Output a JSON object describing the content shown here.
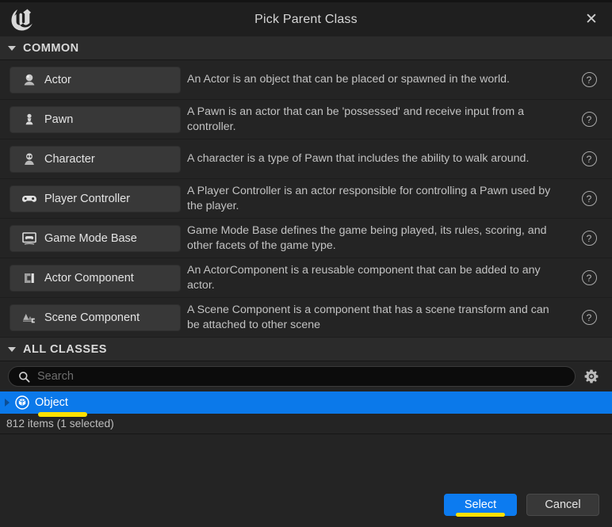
{
  "window": {
    "title": "Pick Parent Class",
    "logo_icon": "unreal-engine-logo",
    "close_icon": "close-icon"
  },
  "common_section": {
    "header": "COMMON",
    "collapse_icon": "triangle-down-icon",
    "items": [
      {
        "label": "Actor",
        "icon": "actor-icon",
        "description": "An Actor is an object that can be placed or spawned in the world.",
        "help_icon": "question-mark-icon"
      },
      {
        "label": "Pawn",
        "icon": "pawn-icon",
        "description": "A Pawn is an actor that can be 'possessed' and receive input from a controller.",
        "help_icon": "question-mark-icon"
      },
      {
        "label": "Character",
        "icon": "character-icon",
        "description": "A character is a type of Pawn that includes the ability to walk around.",
        "help_icon": "question-mark-icon"
      },
      {
        "label": "Player Controller",
        "icon": "gamepad-icon",
        "description": "A Player Controller is an actor responsible for controlling a Pawn used by the player.",
        "help_icon": "question-mark-icon"
      },
      {
        "label": "Game Mode Base",
        "icon": "game-mode-icon",
        "description": "Game Mode Base defines the game being played, its rules, scoring, and other facets of the game type.",
        "help_icon": "question-mark-icon"
      },
      {
        "label": "Actor Component",
        "icon": "actor-component-icon",
        "description": "An ActorComponent is a reusable component that can be added to any actor.",
        "help_icon": "question-mark-icon"
      },
      {
        "label": "Scene Component",
        "icon": "scene-component-icon",
        "description": "A Scene Component is a component that has a scene transform and can be attached to other scene",
        "help_icon": "question-mark-icon"
      }
    ]
  },
  "all_classes_section": {
    "header": "ALL CLASSES",
    "collapse_icon": "triangle-down-icon",
    "search": {
      "value": "",
      "placeholder": "Search",
      "icon": "search-icon"
    },
    "settings_icon": "gear-icon",
    "tree": [
      {
        "label": "Object",
        "icon": "object-icon",
        "expand_icon": "triangle-right-icon",
        "selected": true
      }
    ],
    "status": "812 items (1 selected)"
  },
  "footer": {
    "select_label": "Select",
    "cancel_label": "Cancel"
  },
  "colors": {
    "accent_blue": "#0c7bf0",
    "selection_blue": "#0b79ea",
    "highlight_yellow": "#ffe000",
    "panel_bg": "#242424",
    "header_bg": "#2b2b2b",
    "titlebar_bg": "#1f1f1f",
    "button_bg": "#383838"
  }
}
